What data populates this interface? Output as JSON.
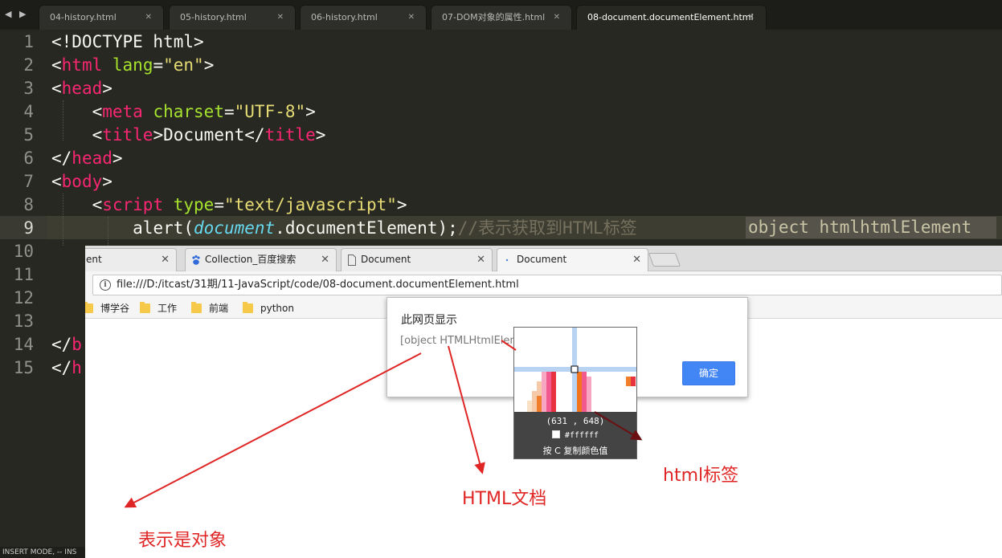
{
  "editor": {
    "tabs": [
      {
        "label": "04-history.html",
        "active": false
      },
      {
        "label": "05-history.html",
        "active": false
      },
      {
        "label": "06-history.html",
        "active": false
      },
      {
        "label": "07-DOM对象的属性.html",
        "active": false
      },
      {
        "label": "08-document.documentElement.html",
        "active": true
      }
    ],
    "line_numbers": [
      "1",
      "2",
      "3",
      "4",
      "5",
      "6",
      "7",
      "8",
      "9",
      "10",
      "11",
      "12",
      "13",
      "14",
      "15"
    ],
    "current_line": 9,
    "code": {
      "l1": "<!DOCTYPE html>",
      "l2_open": "<",
      "l2_tag": "html",
      "l2_attr": "lang",
      "l2_eq": "=",
      "l2_val": "\"en\"",
      "l2_close": ">",
      "l3_open": "<",
      "l3_tag": "head",
      "l3_close": ">",
      "l4_open": "<",
      "l4_tag": "meta",
      "l4_attr": "charset",
      "l4_eq": "=",
      "l4_val": "\"UTF-8\"",
      "l4_close": ">",
      "l5_open": "<",
      "l5_tag": "title",
      "l5_close": ">",
      "l5_text": "Document",
      "l5_end_open": "</",
      "l5_end_tag": "title",
      "l5_end_close": ">",
      "l6_open": "</",
      "l6_tag": "head",
      "l6_close": ">",
      "l7_open": "<",
      "l7_tag": "body",
      "l7_close": ">",
      "l8_open": "<",
      "l8_tag": "script",
      "l8_attr": "type",
      "l8_eq": "=",
      "l8_val": "\"text/javascript\"",
      "l8_close": ">",
      "l9_fn": "alert(",
      "l9_obj": "document",
      "l9_rest": ".documentElement);",
      "l9_comment": "//表示获取到HTML标签",
      "l9_highlight": "object htmlhtmlElement",
      "l14_open": "</",
      "l14_tag": "b",
      "l15_open": "</",
      "l15_tag": "h"
    },
    "status": "INSERT MODE, -- INS"
  },
  "browser": {
    "tabs": [
      {
        "label": "ent",
        "icon": "page-icon"
      },
      {
        "label": "Collection_百度搜索",
        "icon": "baidu-paw-icon"
      },
      {
        "label": "Document",
        "icon": "page-icon"
      },
      {
        "label": "Document",
        "icon": "loading-dot-icon"
      }
    ],
    "url": "file:///D:/itcast/31期/11-JavaScript/code/08-document.documentElement.html",
    "bookmarks": [
      "博学谷",
      "工作",
      "前端",
      "python"
    ],
    "dialog": {
      "title": "此网页显示",
      "message": "[object HTMLHtmlElem",
      "ok_label": "确定"
    }
  },
  "picker": {
    "coord": "(631 , 648)",
    "hex": "#ffffff",
    "hint": "按 C 复制颜色值"
  },
  "annotations": {
    "object": "表示是对象",
    "html_doc": "HTML文档",
    "html_tag": "html标签",
    "color": "#e02525"
  }
}
